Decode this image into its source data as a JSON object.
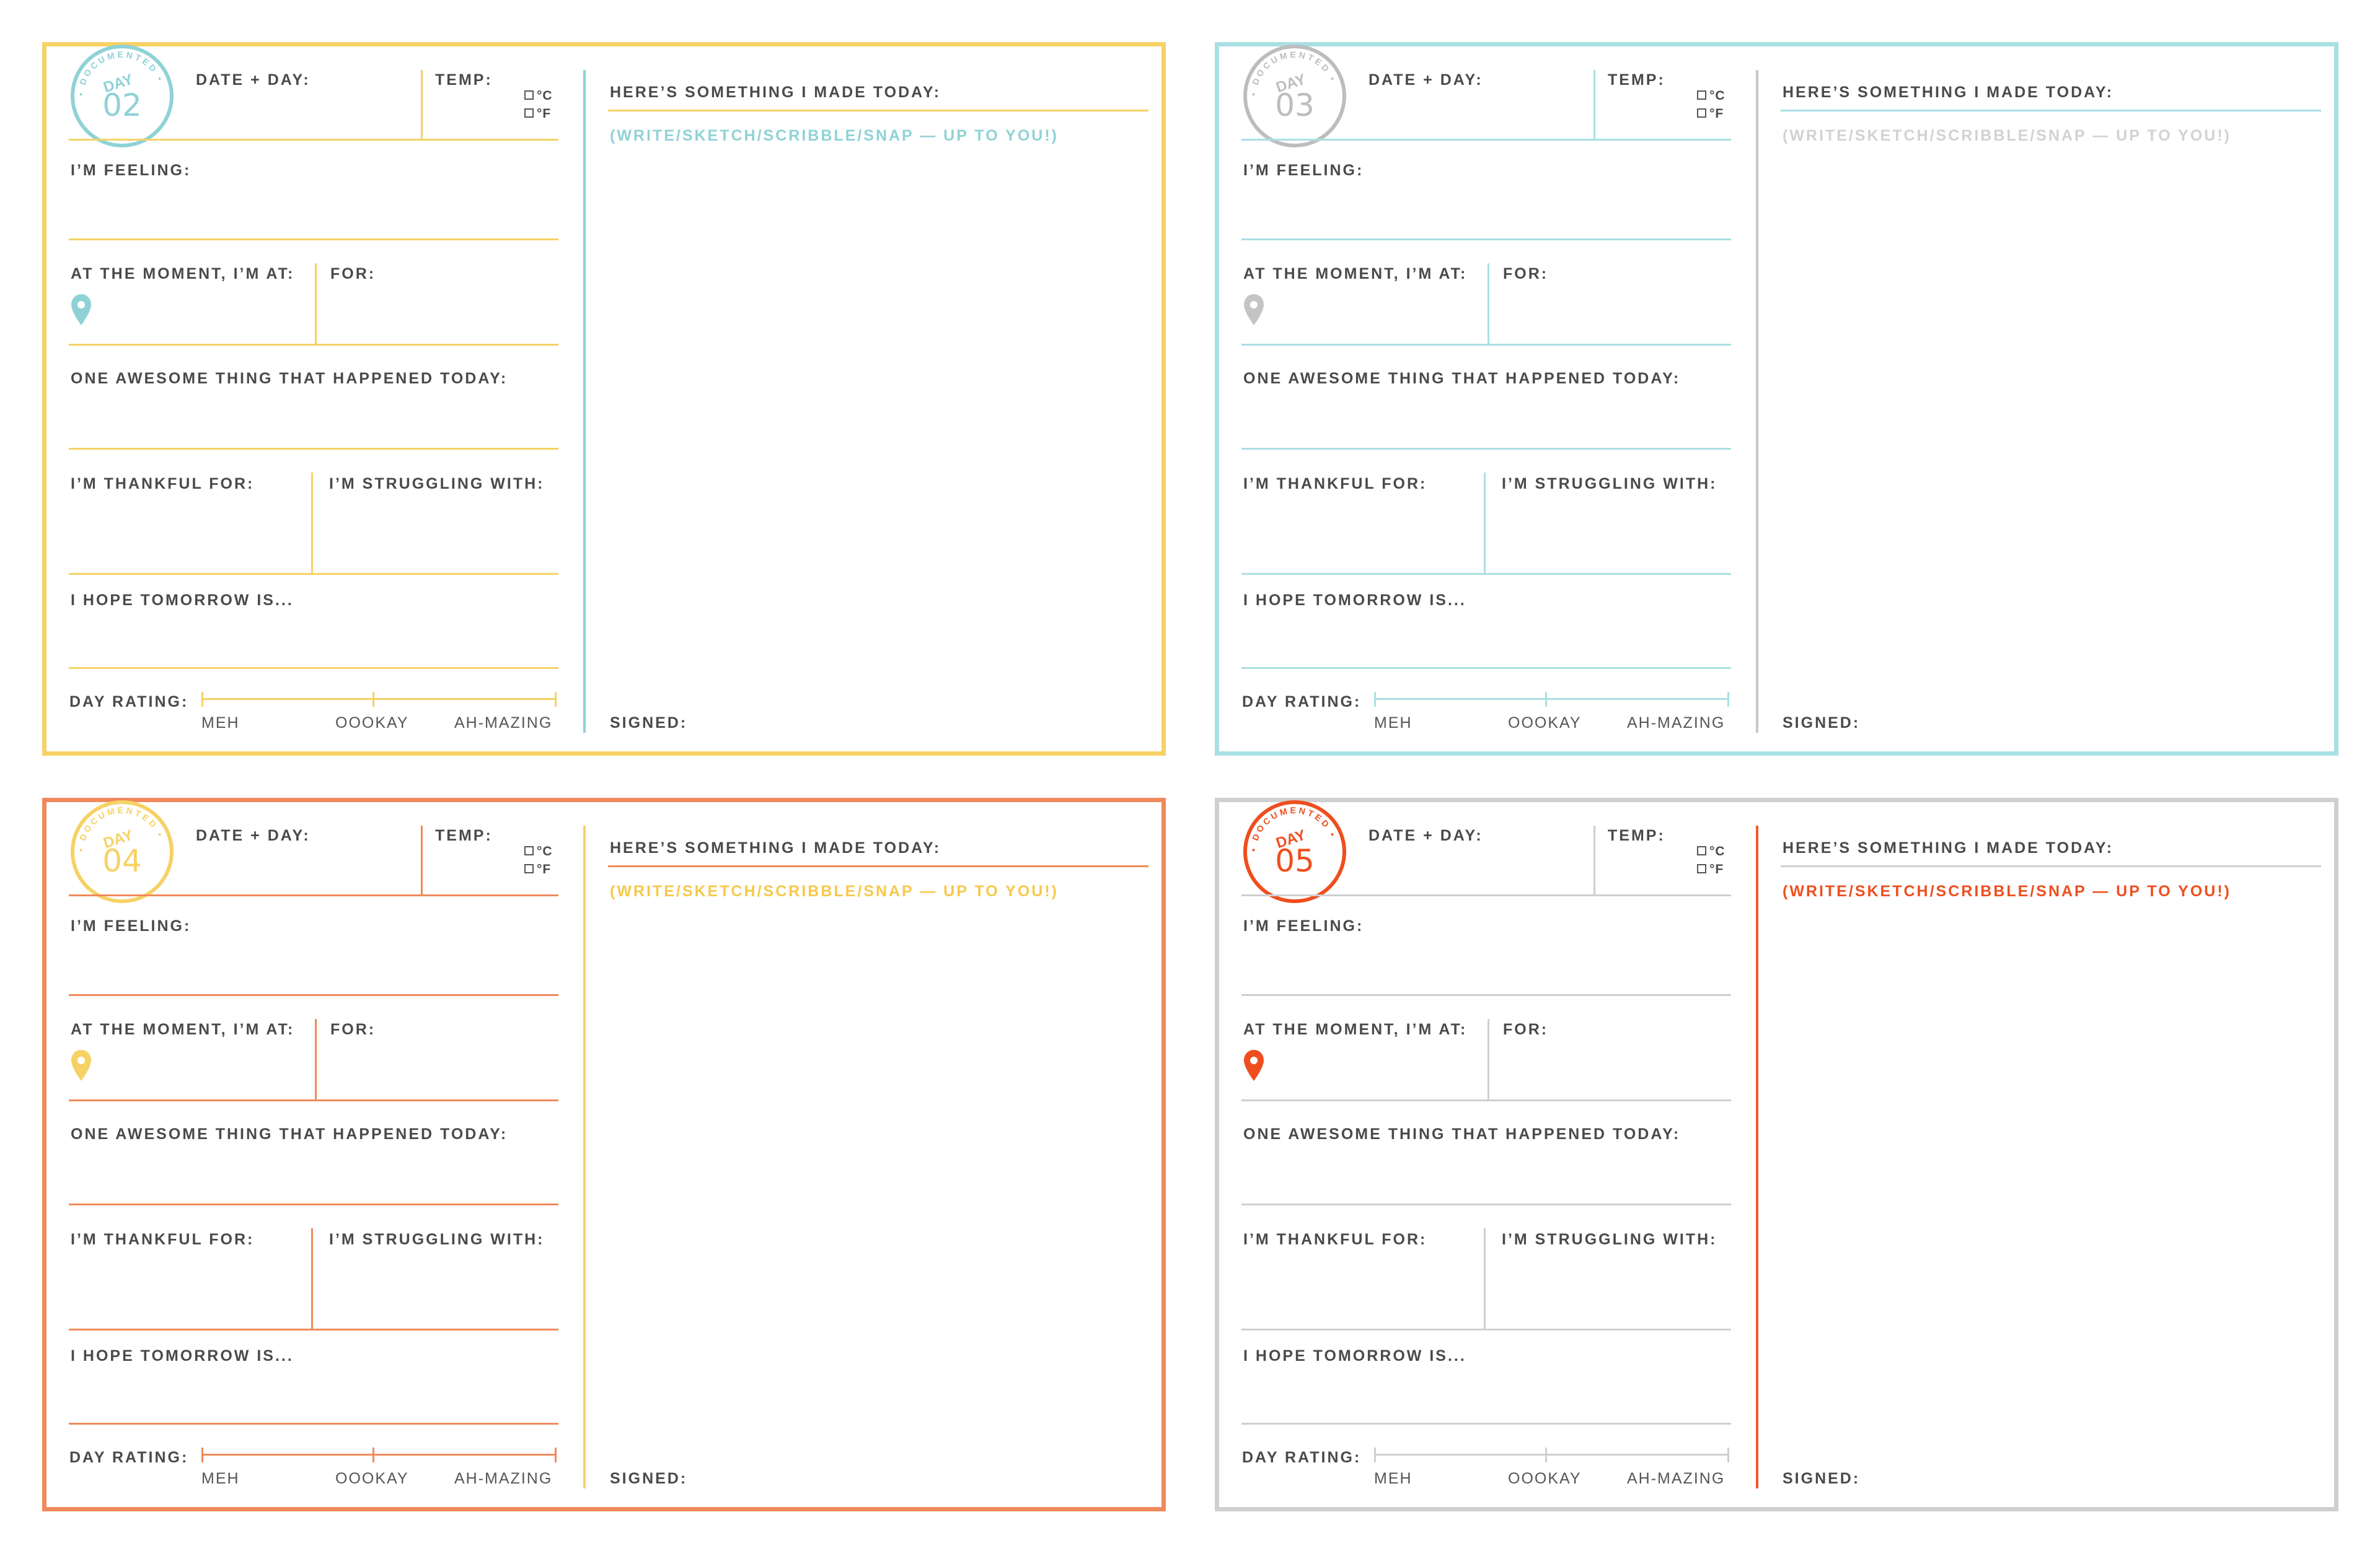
{
  "labels": {
    "date_day": "DATE + DAY:",
    "temp": "TEMP:",
    "celsius": "°C",
    "fahrenheit": "°F",
    "feeling": "I’M FEELING:",
    "at_moment": "AT THE MOMENT, I’M AT:",
    "for": "FOR:",
    "awesome": "ONE AWESOME THING THAT HAPPENED TODAY:",
    "thankful": "I’M THANKFUL FOR:",
    "struggling": "I’M STRUGGLING WITH:",
    "hope": "I HOPE TOMORROW IS...",
    "day_rating": "DAY RATING:",
    "meh": "MEH",
    "oookay": "OOOKAY",
    "ahmazing": "AH-MAZING",
    "made_today": "HERE’S SOMETHING I MADE TODAY:",
    "prompt": "(WRITE/SKETCH/SCRIBBLE/SNAP — UP TO YOU!)",
    "signed": "SIGNED:",
    "stamp_day": "DAY",
    "stamp_ring": "• DOCUMENTED •"
  },
  "cards": [
    {
      "day_number": "02",
      "colors": {
        "border": "#f6d265",
        "line": "#f6d265",
        "line2": "#f6d265",
        "vcol": "#8fd2d6",
        "stamp": "#8fd2d6",
        "prompt": "#8fd2d6",
        "pin": "#8fd2d6"
      }
    },
    {
      "day_number": "03",
      "colors": {
        "border": "#a9e0e3",
        "line": "#a9e0e3",
        "line2": "#a9e0e3",
        "vcol": "#c8c8c8",
        "stamp": "#bdbdbd",
        "prompt": "#d2d2d2",
        "pin": "#c4c4c4"
      }
    },
    {
      "day_number": "04",
      "colors": {
        "border": "#f08a5c",
        "line": "#f08a5c",
        "line2": "#f08a5c",
        "vcol": "#f6d265",
        "stamp": "#f6d265",
        "prompt": "#f6c94a",
        "pin": "#f6d265"
      }
    },
    {
      "day_number": "05",
      "colors": {
        "border": "#cfcfcf",
        "line": "#cfcfcf",
        "line2": "#cfcfcf",
        "vcol": "#ef5a2a",
        "stamp": "#ef4e1e",
        "prompt": "#ef4e1e",
        "pin": "#ef4e1e"
      }
    }
  ]
}
